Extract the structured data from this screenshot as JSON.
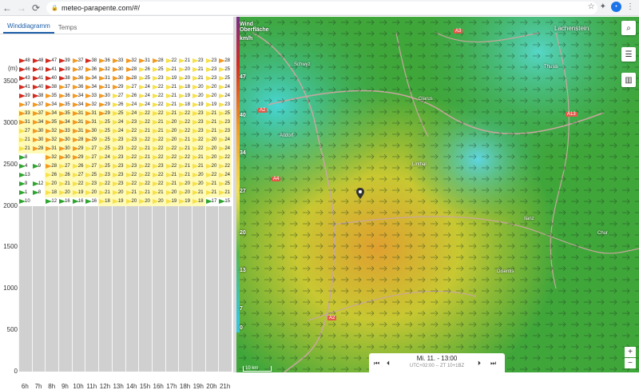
{
  "browser": {
    "url": "meteo-parapente.com/#/"
  },
  "tabs": [
    {
      "label": "Winddiagramm",
      "active": true
    },
    {
      "label": "Temps",
      "active": false
    }
  ],
  "chart_data": {
    "type": "heatmap",
    "ylabel": "(m)",
    "y_ticks": [
      "3500",
      "3000",
      "2500",
      "2000",
      "1500",
      "1000",
      "500",
      "0"
    ],
    "x_ticks": [
      "6h",
      "7h",
      "8h",
      "9h",
      "10h",
      "11h",
      "12h",
      "13h",
      "14h",
      "15h",
      "16h",
      "17h",
      "18h",
      "19h",
      "20h",
      "21h"
    ],
    "ylim": [
      0,
      3800
    ],
    "ground_level_m": 2000,
    "rows": [
      {
        "cells": [
          "48",
          "48",
          "47",
          "39",
          "37",
          "38",
          "36",
          "33",
          "32",
          "31",
          "28",
          "22",
          "21",
          "23",
          "23",
          "28"
        ]
      },
      {
        "cells": [
          "46",
          "43",
          "41",
          "39",
          "37",
          "36",
          "32",
          "30",
          "28",
          "26",
          "25",
          "21",
          "20",
          "21",
          "23",
          "25"
        ]
      },
      {
        "cells": [
          "43",
          "41",
          "40",
          "38",
          "36",
          "34",
          "31",
          "30",
          "28",
          "25",
          "23",
          "19",
          "20",
          "21",
          "23",
          "25"
        ]
      },
      {
        "cells": [
          "41",
          "40",
          "38",
          "37",
          "36",
          "34",
          "31",
          "29",
          "27",
          "24",
          "22",
          "21",
          "18",
          "20",
          "20",
          "24"
        ]
      },
      {
        "cells": [
          "39",
          "38",
          "35",
          "36",
          "34",
          "33",
          "30",
          "27",
          "26",
          "24",
          "22",
          "21",
          "19",
          "20",
          "20",
          "24"
        ]
      },
      {
        "cells": [
          "37",
          "37",
          "34",
          "35",
          "34",
          "32",
          "29",
          "26",
          "24",
          "24",
          "22",
          "21",
          "18",
          "19",
          "19",
          "23"
        ]
      },
      {
        "cells": [
          "33",
          "37",
          "34",
          "35",
          "31",
          "31",
          "29",
          "25",
          "24",
          "22",
          "22",
          "21",
          "22",
          "23",
          "21",
          "25"
        ]
      },
      {
        "cells": [
          "31",
          "34",
          "35",
          "34",
          "31",
          "31",
          "25",
          "24",
          "23",
          "22",
          "21",
          "20",
          "22",
          "23",
          "21",
          "23"
        ]
      },
      {
        "cells": [
          "27",
          "30",
          "32",
          "33",
          "31",
          "30",
          "25",
          "24",
          "22",
          "21",
          "21",
          "20",
          "22",
          "23",
          "21",
          "23"
        ]
      },
      {
        "cells": [
          "21",
          "30",
          "32",
          "30",
          "28",
          "29",
          "25",
          "23",
          "23",
          "22",
          "22",
          "20",
          "21",
          "22",
          "20",
          "24"
        ]
      },
      {
        "cells": [
          "21",
          "28",
          "31",
          "30",
          "29",
          "27",
          "25",
          "23",
          "22",
          "21",
          "22",
          "22",
          "21",
          "22",
          "20",
          "24"
        ]
      },
      {
        "cells": [
          "8",
          "",
          "32",
          "30",
          "29",
          "27",
          "24",
          "23",
          "22",
          "21",
          "22",
          "22",
          "22",
          "21",
          "20",
          "22"
        ]
      },
      {
        "cells": [
          "4",
          "9",
          "28",
          "27",
          "26",
          "27",
          "25",
          "23",
          "23",
          "22",
          "23",
          "22",
          "21",
          "21",
          "20",
          "22"
        ]
      },
      {
        "cells": [
          "13",
          "",
          "26",
          "26",
          "27",
          "25",
          "23",
          "23",
          "22",
          "22",
          "22",
          "21",
          "21",
          "20",
          "22",
          "24"
        ]
      },
      {
        "cells": [
          "9",
          "12",
          "20",
          "21",
          "22",
          "23",
          "22",
          "23",
          "22",
          "22",
          "22",
          "21",
          "20",
          "20",
          "21",
          "25"
        ]
      },
      {
        "cells": [
          "1",
          "8",
          "18",
          "20",
          "19",
          "20",
          "21",
          "20",
          "21",
          "21",
          "21",
          "20",
          "20",
          "21",
          "21",
          "21"
        ]
      },
      {
        "cells": [
          "10",
          "",
          "12",
          "16",
          "16",
          "16",
          "18",
          "19",
          "20",
          "20",
          "20",
          "19",
          "19",
          "18",
          "17",
          "15"
        ]
      }
    ]
  },
  "map": {
    "legend_title": "Wind Oberfläche",
    "legend_unit": "km/h",
    "legend_ticks": [
      "47",
      "40",
      "34",
      "27",
      "20",
      "13",
      "7",
      "0"
    ],
    "places": [
      "Lachenstein",
      "Glarus",
      "Altdorf",
      "Schwyz",
      "Linthal",
      "Chur",
      "Ilanz",
      "Disentis",
      "Thusis"
    ],
    "roads": [
      "A3",
      "A13",
      "A2",
      "A2",
      "A4"
    ],
    "time_main": "Mi. 11. - 13:00",
    "time_sub": "UTC+02:00 -- ZT 10+1BZ",
    "scale": "10 km",
    "zoom_in": "+",
    "zoom_out": "−"
  },
  "colors": {
    "tab_active": "#1e5fa8",
    "ground": "#d0d0d0",
    "arrow_red": "#d42a1e",
    "arrow_orange": "#f39a21",
    "arrow_yellow": "#f7e14a",
    "arrow_green": "#2ea52e"
  }
}
